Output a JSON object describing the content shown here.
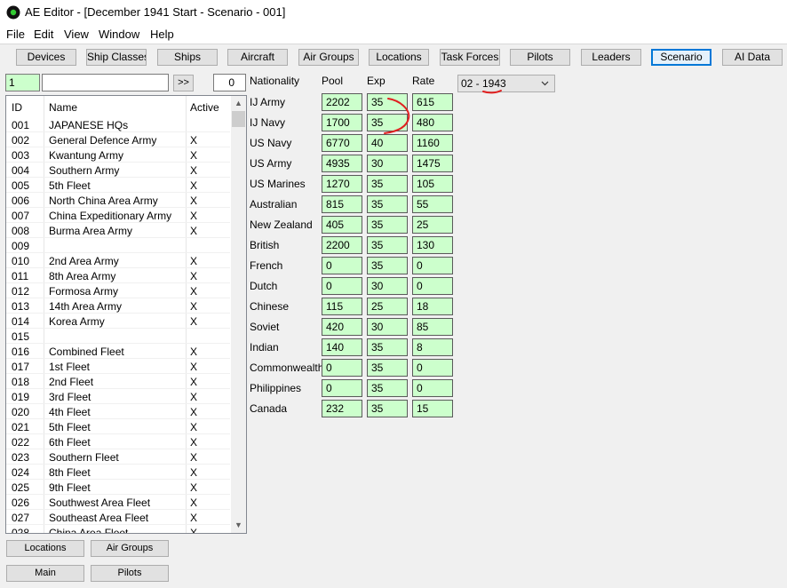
{
  "window": {
    "title": "AE Editor - [December 1941 Start - Scenario - 001]"
  },
  "menu": [
    "File",
    "Edit",
    "View",
    "Window",
    "Help"
  ],
  "toolbar": {
    "buttons": [
      "Devices",
      "Ship Classes",
      "Ships",
      "Aircraft",
      "Air Groups",
      "Locations",
      "Task Forces",
      "Pilots",
      "Leaders",
      "Scenario",
      "AI Data"
    ],
    "active": "Scenario"
  },
  "search": {
    "id_value": "1",
    "name_value": "",
    "go_label": ">>",
    "count": "0"
  },
  "list": {
    "headers": {
      "id": "ID",
      "name": "Name",
      "active": "Active"
    },
    "rows": [
      {
        "id": "001",
        "name": "JAPANESE HQs",
        "active": ""
      },
      {
        "id": "002",
        "name": "General Defence Army",
        "active": "X"
      },
      {
        "id": "003",
        "name": "Kwantung Army",
        "active": "X"
      },
      {
        "id": "004",
        "name": "Southern Army",
        "active": "X"
      },
      {
        "id": "005",
        "name": "5th Fleet",
        "active": "X"
      },
      {
        "id": "006",
        "name": "North China Area Army",
        "active": "X"
      },
      {
        "id": "007",
        "name": "China Expeditionary Army",
        "active": "X"
      },
      {
        "id": "008",
        "name": "Burma Area Army",
        "active": "X"
      },
      {
        "id": "009",
        "name": "",
        "active": ""
      },
      {
        "id": "010",
        "name": "2nd Area Army",
        "active": "X"
      },
      {
        "id": "011",
        "name": "8th Area Army",
        "active": "X"
      },
      {
        "id": "012",
        "name": "Formosa Army",
        "active": "X"
      },
      {
        "id": "013",
        "name": "14th Area Army",
        "active": "X"
      },
      {
        "id": "014",
        "name": "Korea Army",
        "active": "X"
      },
      {
        "id": "015",
        "name": "",
        "active": ""
      },
      {
        "id": "016",
        "name": "Combined Fleet",
        "active": "X"
      },
      {
        "id": "017",
        "name": "1st Fleet",
        "active": "X"
      },
      {
        "id": "018",
        "name": "2nd Fleet",
        "active": "X"
      },
      {
        "id": "019",
        "name": "3rd Fleet",
        "active": "X"
      },
      {
        "id": "020",
        "name": "4th Fleet",
        "active": "X"
      },
      {
        "id": "021",
        "name": "5th Fleet",
        "active": "X"
      },
      {
        "id": "022",
        "name": "6th Fleet",
        "active": "X"
      },
      {
        "id": "023",
        "name": "Southern Fleet",
        "active": "X"
      },
      {
        "id": "024",
        "name": "8th Fleet",
        "active": "X"
      },
      {
        "id": "025",
        "name": "9th Fleet",
        "active": "X"
      },
      {
        "id": "026",
        "name": "Southwest Area Fleet",
        "active": "X"
      },
      {
        "id": "027",
        "name": "Southeast Area Fleet",
        "active": "X"
      },
      {
        "id": "028",
        "name": "China Area Fleet",
        "active": "X"
      }
    ]
  },
  "bottom_buttons": [
    "Locations",
    "Air Groups",
    "Main",
    "Pilots"
  ],
  "grid": {
    "headers": {
      "nationality": "Nationality",
      "pool": "Pool",
      "exp": "Exp",
      "rate": "Rate"
    },
    "rows": [
      {
        "nation": "IJ Army",
        "pool": "2202",
        "exp": "35",
        "rate": "615"
      },
      {
        "nation": "IJ Navy",
        "pool": "1700",
        "exp": "35",
        "rate": "480"
      },
      {
        "nation": "US Navy",
        "pool": "6770",
        "exp": "40",
        "rate": "1160"
      },
      {
        "nation": "US Army",
        "pool": "4935",
        "exp": "30",
        "rate": "1475"
      },
      {
        "nation": "US Marines",
        "pool": "1270",
        "exp": "35",
        "rate": "105"
      },
      {
        "nation": "Australian",
        "pool": "815",
        "exp": "35",
        "rate": "55"
      },
      {
        "nation": "New Zealand",
        "pool": "405",
        "exp": "35",
        "rate": "25"
      },
      {
        "nation": "British",
        "pool": "2200",
        "exp": "35",
        "rate": "130"
      },
      {
        "nation": "French",
        "pool": "0",
        "exp": "35",
        "rate": "0"
      },
      {
        "nation": "Dutch",
        "pool": "0",
        "exp": "30",
        "rate": "0"
      },
      {
        "nation": "Chinese",
        "pool": "115",
        "exp": "25",
        "rate": "18"
      },
      {
        "nation": "Soviet",
        "pool": "420",
        "exp": "30",
        "rate": "85"
      },
      {
        "nation": "Indian",
        "pool": "140",
        "exp": "35",
        "rate": "8"
      },
      {
        "nation": "Commonwealth",
        "pool": "0",
        "exp": "35",
        "rate": "0"
      },
      {
        "nation": "Philippines",
        "pool": "0",
        "exp": "35",
        "rate": "0"
      },
      {
        "nation": "Canada",
        "pool": "232",
        "exp": "35",
        "rate": "15"
      }
    ]
  },
  "date_select": {
    "value": "02 - 1943"
  },
  "colors": {
    "field_green": "#ccffcc",
    "annotation_red": "#e02020",
    "active_blue": "#0078d7"
  }
}
